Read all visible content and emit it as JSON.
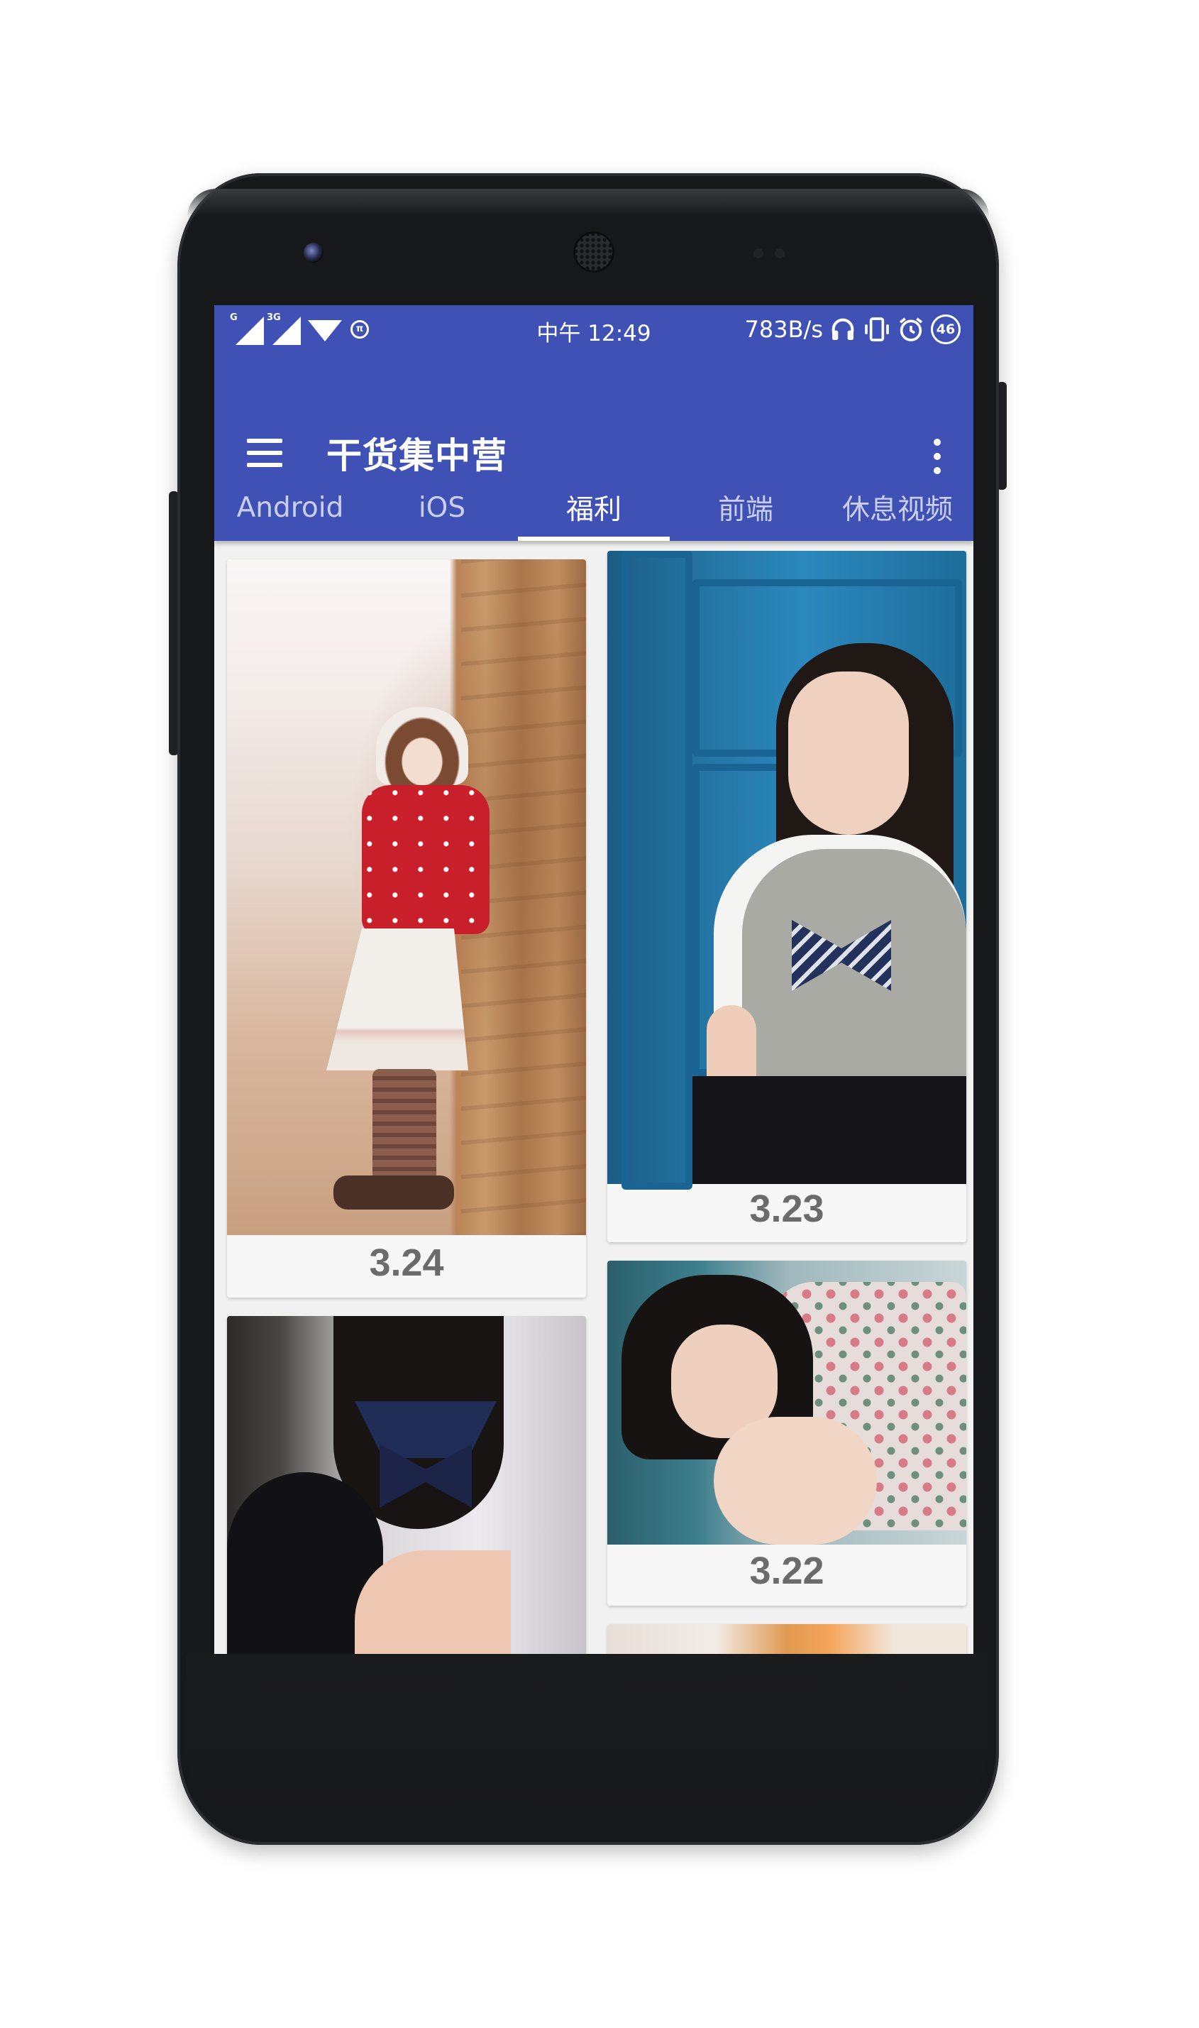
{
  "status_bar": {
    "sim1_tag": "G",
    "sim2_tag": "3G",
    "time": "中午 12:49",
    "net_speed": "783B/s",
    "battery": "46"
  },
  "app_bar": {
    "title": "干货集中营"
  },
  "tabs": [
    {
      "label": "Android",
      "active": false
    },
    {
      "label": "iOS",
      "active": false
    },
    {
      "label": "福利",
      "active": true
    },
    {
      "label": "前端",
      "active": false
    },
    {
      "label": "休息视频",
      "active": false
    }
  ],
  "feed": {
    "cards": [
      {
        "date": "3.24"
      },
      {
        "date": "3.23"
      },
      {
        "date": ""
      },
      {
        "date": "3.22"
      },
      {
        "date": ""
      }
    ]
  },
  "colors": {
    "primary": "#3f51b5",
    "background": "#f1f1f1",
    "date_text": "#6b6b6b"
  },
  "icons": {
    "status_left": [
      "signal-icon",
      "signal-icon",
      "wifi-icon",
      "pi-icon"
    ],
    "status_right": [
      "headphones-icon",
      "vibrate-icon",
      "alarm-icon",
      "battery-icon"
    ],
    "app_bar_left": "menu-icon",
    "app_bar_right": "more-vert-icon"
  }
}
